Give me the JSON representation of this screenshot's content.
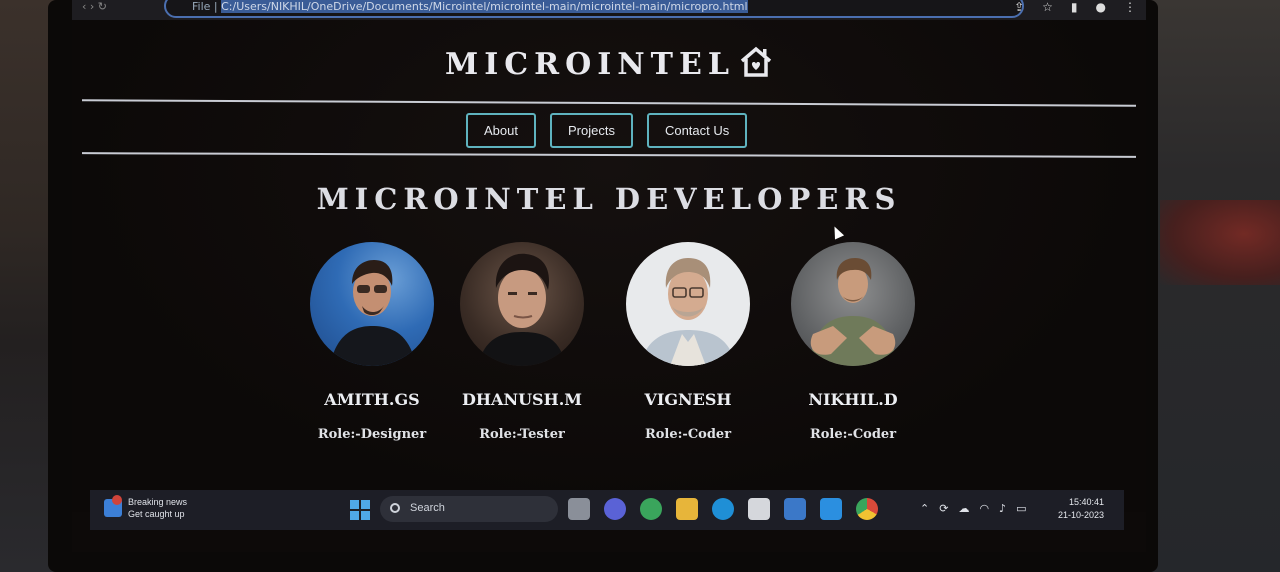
{
  "browser": {
    "url_prefix": "File |",
    "url": "C:/Users/NIKHIL/OneDrive/Documents/Microintel/microintel-main/microintel-main/micropro.html"
  },
  "header": {
    "brand": "MICROINTEL"
  },
  "nav": [
    {
      "label": "About"
    },
    {
      "label": "Projects"
    },
    {
      "label": "Contact Us"
    }
  ],
  "main": {
    "heading": "MICROINTEL DEVELOPERS",
    "members": [
      {
        "name": "AMITH.GS",
        "role": "Role:-Designer"
      },
      {
        "name": "DHANUSH.M",
        "role": "Role:-Tester"
      },
      {
        "name": "VIGNESH",
        "role": "Role:-Coder"
      },
      {
        "name": "NIKHIL.D",
        "role": "Role:-Coder"
      }
    ]
  },
  "taskbar": {
    "news_title": "Breaking news",
    "news_subtitle": "Get caught up",
    "news_badge": "1",
    "search_placeholder": "Search",
    "time": "15:40:41",
    "date": "21-10-2023"
  },
  "colors": {
    "nav_border": "#5fb3bf",
    "page_bg": "#0d0a09",
    "text": "#e9e9ee"
  }
}
